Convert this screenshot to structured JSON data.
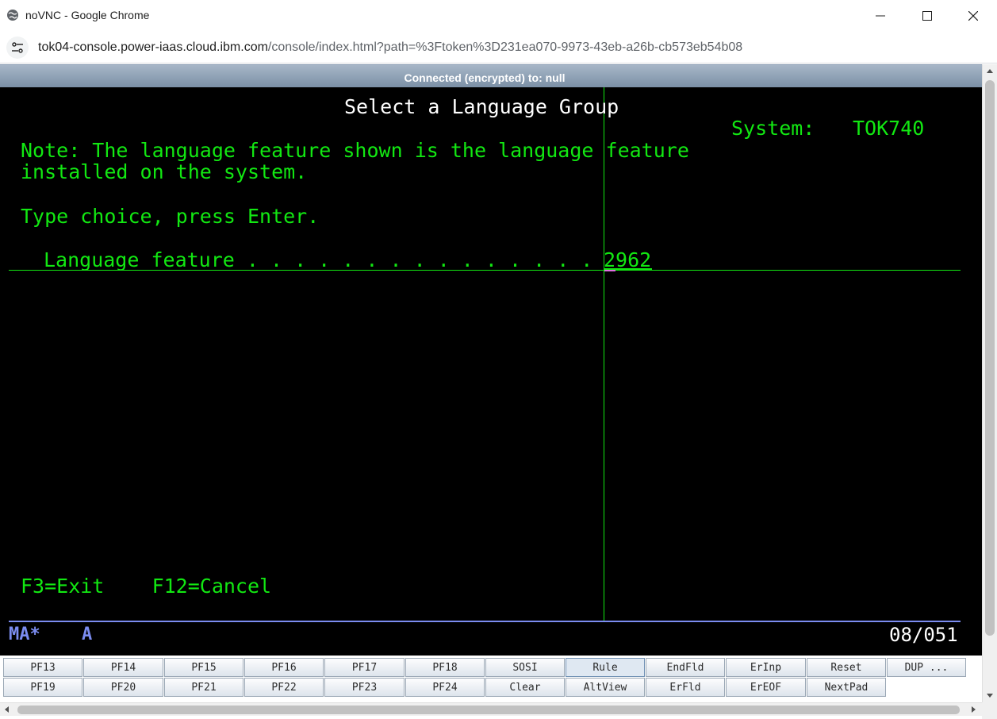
{
  "window": {
    "title": "noVNC - Google Chrome",
    "url_host": "tok04-console.power-iaas.cloud.ibm.com",
    "url_rest": "/console/index.html?path=%3Ftoken%3D231ea070-9973-43eb-a26b-cb573eb54b08"
  },
  "vnc": {
    "status": "Connected (encrypted) to: null"
  },
  "screen": {
    "title": "Select a Language Group",
    "system_label": "System:",
    "system_name": "TOK740",
    "note_line1": "Note: The language feature shown is the language feature",
    "note_line2": "installed on the system.",
    "instruction": "Type choice, press Enter.",
    "field_label": "Language feature . . . . . . . . . . . . . . .",
    "field_value": "2962",
    "fkeys": "F3=Exit    F12=Cancel",
    "status_left": "MA*",
    "status_mode": "A",
    "cursor_pos": "08/051"
  },
  "keypad": {
    "row1": [
      "PF13",
      "PF14",
      "PF15",
      "PF16",
      "PF17",
      "PF18",
      "SOSI",
      "Rule",
      "EndFld",
      "ErInp",
      "Reset",
      "DUP ..."
    ],
    "row2": [
      "PF19",
      "PF20",
      "PF21",
      "PF22",
      "PF23",
      "PF24",
      "Clear",
      "AltView",
      "ErFld",
      "ErEOF",
      "NextPad"
    ],
    "active": "Rule"
  },
  "colors": {
    "terminal_green": "#12e812",
    "terminal_blue": "#7b8cf0",
    "cursor_pink": "#e070e0"
  },
  "icons": {
    "favicon": "globe-icon",
    "site_info": "tune-icon",
    "minimize": "minimize-icon",
    "maximize": "maximize-icon",
    "close": "close-icon"
  }
}
